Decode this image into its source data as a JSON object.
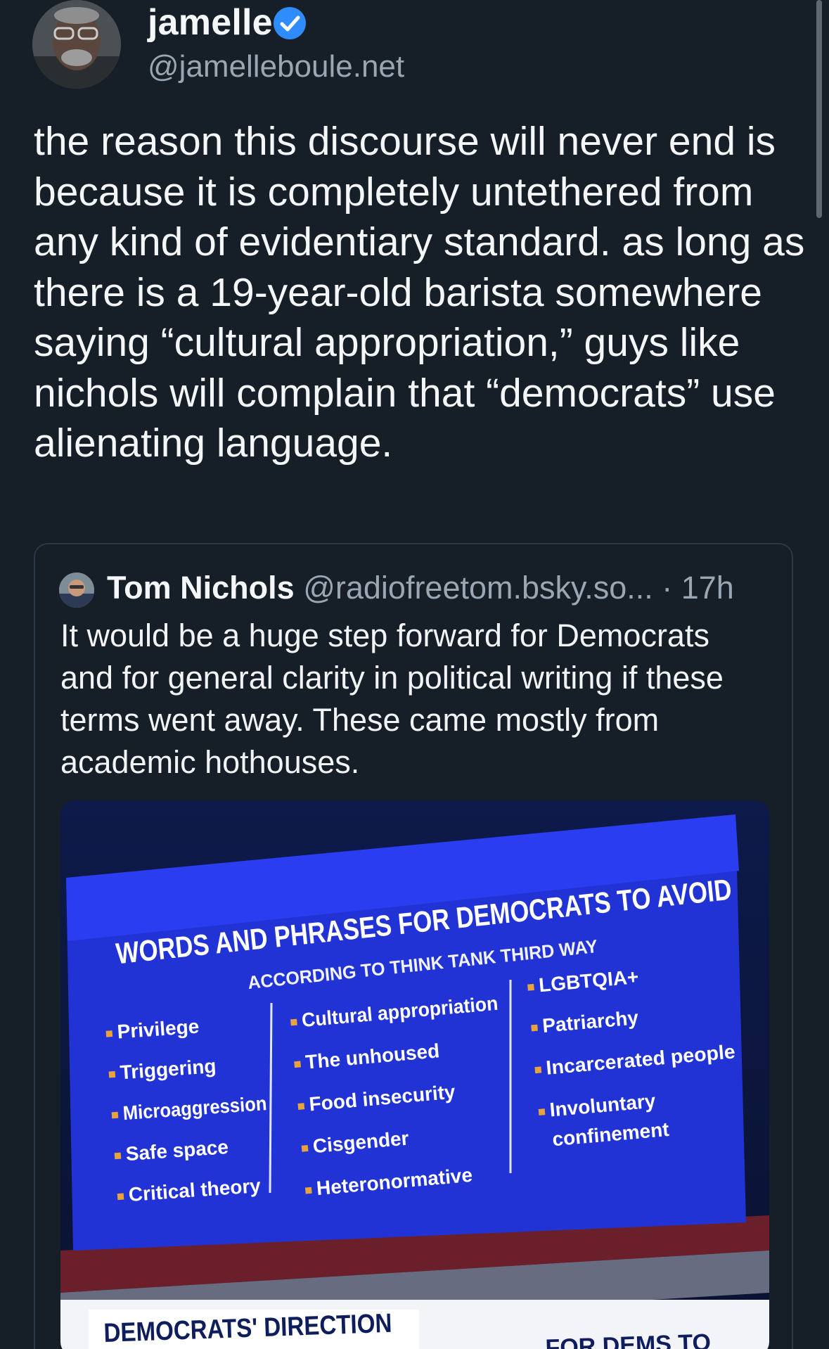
{
  "author": {
    "display_name": "jamelle",
    "handle": "@jamelleboule.net",
    "verified_icon": "verified-check-icon"
  },
  "post": {
    "text": "the reason this discourse will never end is because it is completely untethered from any kind of evidentiary standard. as long as there is a 19-year-old barista somewhere saying “cultural appropriation,” guys like nichols will complain that “democrats” use alienating language."
  },
  "quote": {
    "display_name": "Tom Nichols",
    "handle": "@radiofreetom.bsky.so...",
    "time": "· 17h",
    "text": "It would be a huge step forward for Democrats and for general clarity in political writing if these terms went away. These came mostly from academic hothouses."
  },
  "image": {
    "title": "WORDS AND PHRASES FOR DEMOCRATS TO AVOID",
    "subtitle": "ACCORDING TO THINK TANK THIRD WAY",
    "col1": [
      "Privilege",
      "Triggering",
      "Microaggression",
      "Safe space",
      "Critical theory"
    ],
    "col2": [
      "Cultural appropriation",
      "The unhoused",
      "Food insecurity",
      "Cisgender",
      "Heteronormative"
    ],
    "col3": [
      "LGBTQIA+",
      "Patriarchy",
      "Incarcerated people",
      "Involuntary",
      "confinement"
    ],
    "banner": "DEMOCRATS' DIRECTION",
    "ticker": "FOR DEMS TO",
    "colors": {
      "screen_blue": "#2233d6",
      "bright_blue": "#2b3df0",
      "text_white": "#ffffff",
      "bullet_orange": "#e8a33a"
    }
  }
}
